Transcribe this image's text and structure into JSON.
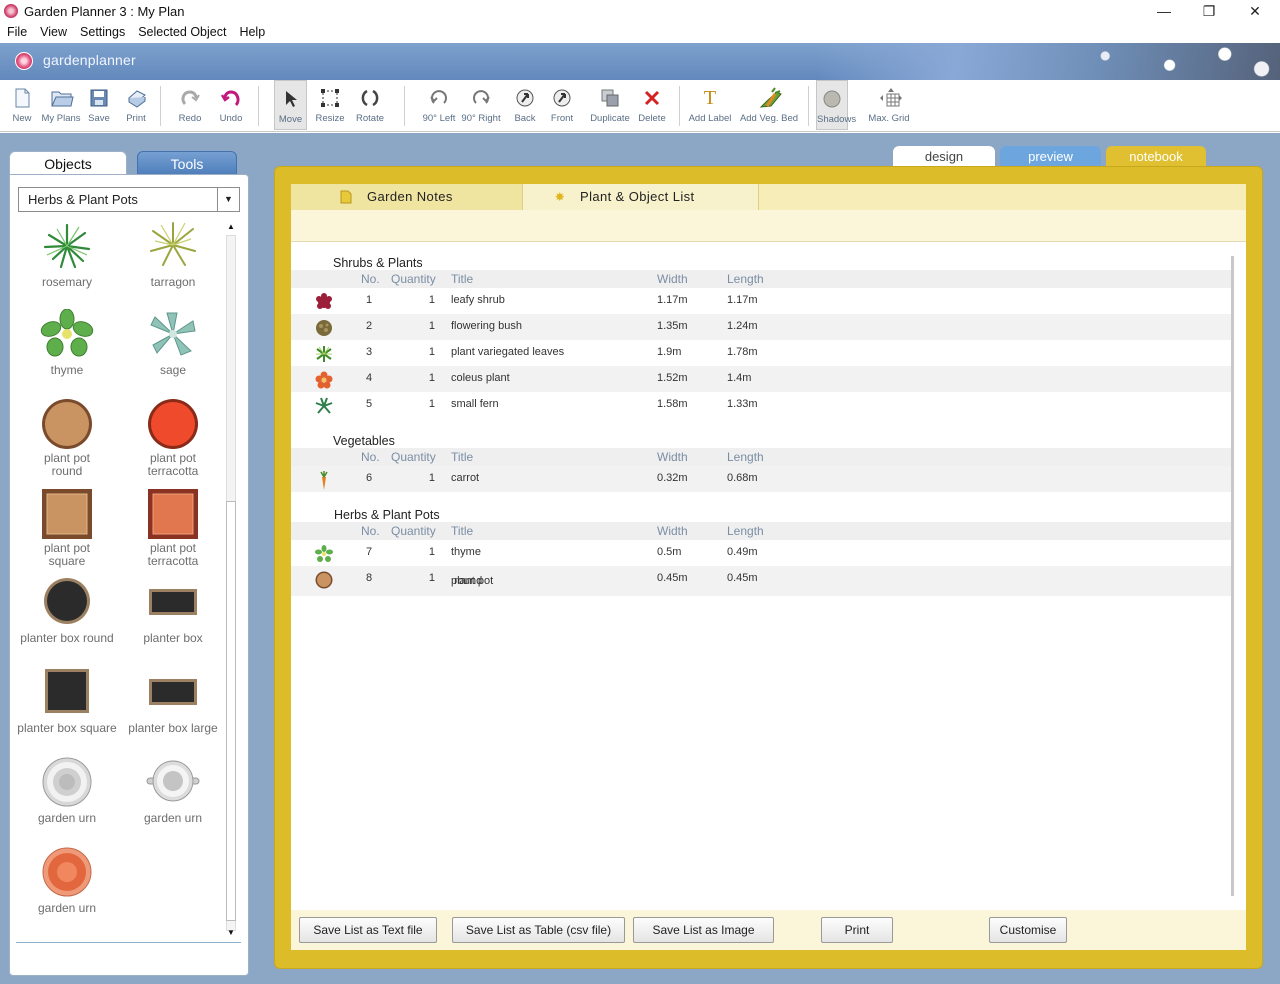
{
  "window": {
    "title": "Garden Planner 3 : My  Plan",
    "minimize": "—",
    "restore": "❐",
    "close": "✕"
  },
  "menu": [
    "File",
    "View",
    "Settings",
    "Selected Object",
    "Help"
  ],
  "banner": {
    "logo_text": "gardenplanner"
  },
  "toolbar": {
    "new": "New",
    "my_plans": "My Plans",
    "save": "Save",
    "print": "Print",
    "redo": "Redo",
    "undo": "Undo",
    "move": "Move",
    "resize": "Resize",
    "rotate": "Rotate",
    "rot_left": "90° Left",
    "rot_right": "90° Right",
    "back": "Back",
    "front": "Front",
    "duplicate": "Duplicate",
    "delete": "Delete",
    "add_label": "Add Label",
    "add_veg_bed": "Add Veg. Bed",
    "shadows": "Shadows",
    "max_grid": "Max. Grid"
  },
  "left_panel": {
    "tab_objects": "Objects",
    "tab_tools": "Tools",
    "category": "Herbs & Plant Pots",
    "objects": [
      {
        "line1": "rosemary",
        "line2": ""
      },
      {
        "line1": "tarragon",
        "line2": ""
      },
      {
        "line1": "thyme",
        "line2": ""
      },
      {
        "line1": "sage",
        "line2": ""
      },
      {
        "line1": "plant pot",
        "line2": "round"
      },
      {
        "line1": "plant pot",
        "line2": "terracotta"
      },
      {
        "line1": "plant pot",
        "line2": "square"
      },
      {
        "line1": "plant pot",
        "line2": "terracotta"
      },
      {
        "line1": "planter box round",
        "line2": ""
      },
      {
        "line1": "planter box",
        "line2": ""
      },
      {
        "line1": "planter box square",
        "line2": ""
      },
      {
        "line1": "planter box large",
        "line2": ""
      },
      {
        "line1": "garden urn",
        "line2": ""
      },
      {
        "line1": "garden urn",
        "line2": ""
      },
      {
        "line1": "garden urn",
        "line2": ""
      }
    ]
  },
  "view_tabs": {
    "design": "design",
    "preview": "preview",
    "notebook": "notebook"
  },
  "notebook": {
    "tab_notes": "Garden Notes",
    "tab_list": "Plant & Object List",
    "columns": {
      "no": "No.",
      "qty": "Quantity",
      "title": "Title",
      "width": "Width",
      "length": "Length"
    },
    "sections": [
      {
        "title": "Shrubs & Plants",
        "rows": [
          {
            "no": "1",
            "qty": "1",
            "title": "leafy shrub",
            "width": "1.17m",
            "length": "1.17m"
          },
          {
            "no": "2",
            "qty": "1",
            "title": "flowering bush",
            "width": "1.35m",
            "length": "1.24m"
          },
          {
            "no": "3",
            "qty": "1",
            "title": "plant variegated leaves",
            "width": "1.9m",
            "length": "1.78m"
          },
          {
            "no": "4",
            "qty": "1",
            "title": "coleus plant",
            "width": "1.52m",
            "length": "1.4m"
          },
          {
            "no": "5",
            "qty": "1",
            "title": "small fern",
            "width": "1.58m",
            "length": "1.33m"
          }
        ]
      },
      {
        "title": "Vegetables",
        "rows": [
          {
            "no": "6",
            "qty": "1",
            "title": "carrot",
            "width": "0.32m",
            "length": "0.68m"
          }
        ]
      },
      {
        "title": "Herbs & Plant Pots",
        "rows": [
          {
            "no": "7",
            "qty": "1",
            "title": "thyme",
            "width": "0.5m",
            "length": "0.49m"
          },
          {
            "no": "8",
            "qty": "1",
            "title": "plant pot",
            "title2": "round",
            "width": "0.45m",
            "length": "0.45m"
          }
        ]
      }
    ],
    "buttons": {
      "save_text": "Save List as Text file",
      "save_csv": "Save List as Table (csv file)",
      "save_image": "Save List as Image",
      "print": "Print",
      "customise": "Customise"
    }
  }
}
